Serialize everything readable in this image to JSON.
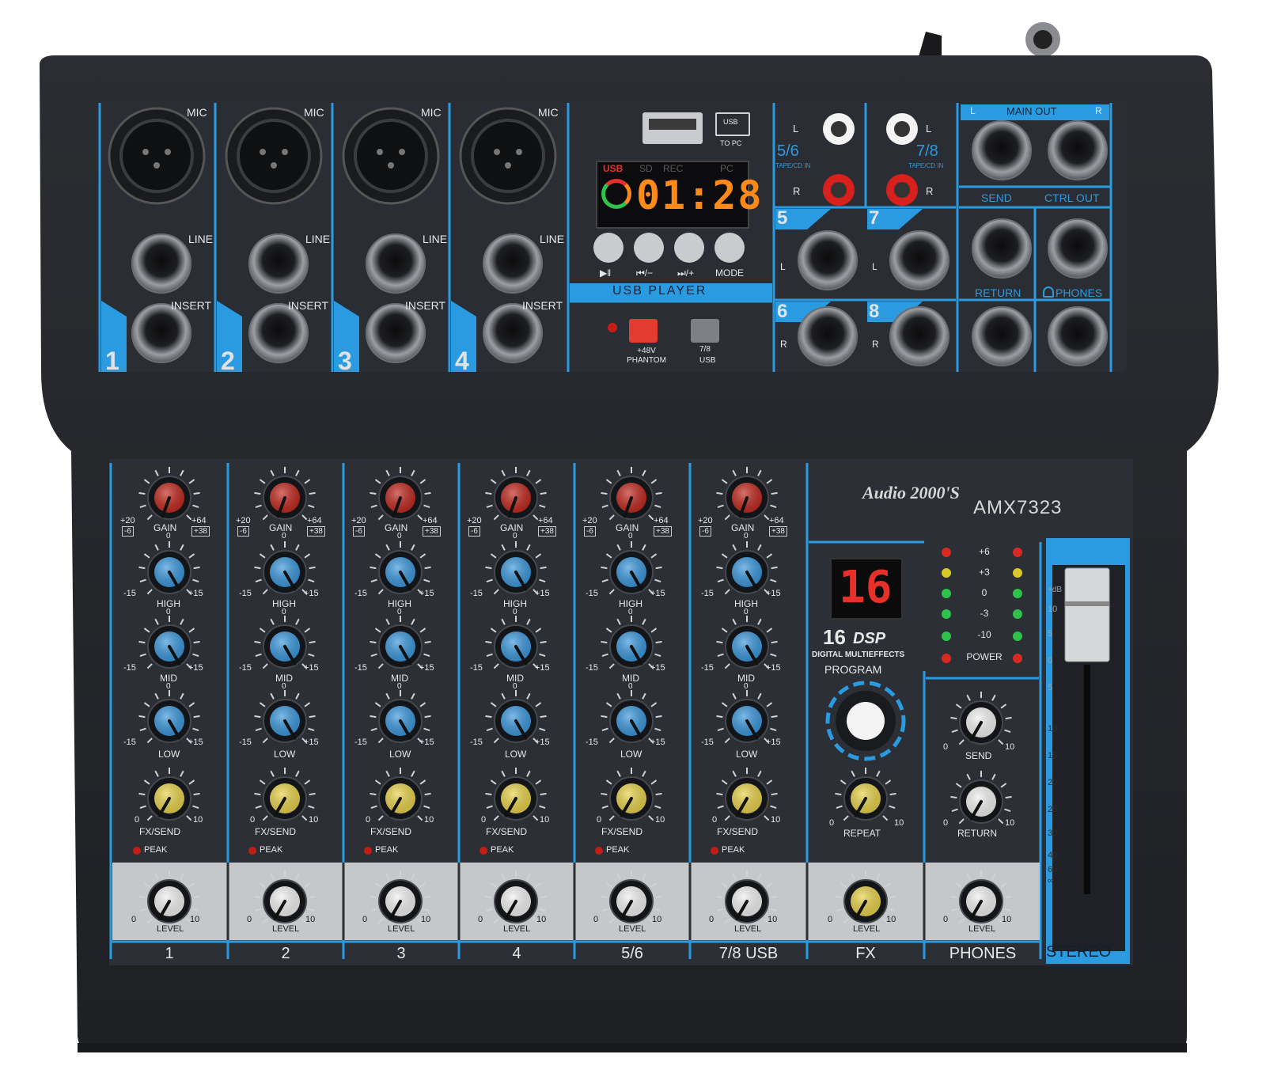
{
  "brand": {
    "logo_text": "Audio 2000'S",
    "model": "AMX7323"
  },
  "inputs": {
    "channels": [
      {
        "number": "1",
        "mic": "MIC",
        "line": "LINE",
        "insert": "INSERT"
      },
      {
        "number": "2",
        "mic": "MIC",
        "line": "LINE",
        "insert": "INSERT"
      },
      {
        "number": "3",
        "mic": "MIC",
        "line": "LINE",
        "insert": "INSERT"
      },
      {
        "number": "4",
        "mic": "MIC",
        "line": "LINE",
        "insert": "INSERT"
      }
    ]
  },
  "usb_player": {
    "title": "USB PLAYER",
    "to_pc": "TO PC",
    "usb_icon_label": "USB",
    "display": {
      "usb": "USB",
      "sd": "SD",
      "rec": "REC",
      "pc": "PC",
      "time": "01:28"
    },
    "buttons": [
      "▶‖",
      "⏮/−",
      "⏭/+",
      "MODE"
    ]
  },
  "switches": {
    "phantom": "+48V PHANTOM",
    "source_top": "7/8",
    "source_bottom": "USB"
  },
  "tape_inputs": {
    "left_group": {
      "label": "5/6",
      "sub": "TAPE/CD IN"
    },
    "right_group": {
      "label": "7/8",
      "sub": "TAPE/CD IN"
    },
    "l": "L",
    "r": "R"
  },
  "stereo_inputs": {
    "ch5": "5",
    "ch6": "6",
    "ch7": "7",
    "ch8": "8",
    "l": "L",
    "r": "R"
  },
  "outputs": {
    "main_out": "MAIN OUT",
    "l": "L",
    "r": "R",
    "send": "SEND",
    "ctrl_out": "CTRL OUT",
    "return": "RETURN",
    "phones": "PHONES"
  },
  "channel_strip": {
    "gain": {
      "label": "GAIN",
      "min_top": "+20",
      "min_bottom": "-6",
      "max_top": "+64",
      "max_bottom": "+38",
      "zero": "0"
    },
    "high": {
      "label": "HIGH",
      "min": "-15",
      "max": "+15",
      "zero": "0"
    },
    "mid": {
      "label": "MID",
      "min": "-15",
      "max": "+15",
      "zero": "0"
    },
    "low": {
      "label": "LOW",
      "min": "-15",
      "max": "+15",
      "zero": "0"
    },
    "fx": {
      "label": "FX/SEND",
      "min": "0",
      "max": "10"
    },
    "peak": "PEAK",
    "level": {
      "label": "LEVEL",
      "min": "0",
      "max": "10"
    }
  },
  "channel_labels": [
    "1",
    "2",
    "3",
    "4",
    "5/6",
    "7/8 USB",
    "FX",
    "PHONES"
  ],
  "dsp": {
    "program_display": "16",
    "count": "16",
    "dsp_text": "DSP",
    "desc": "DIGITAL MULTIEFFECTS",
    "program": "PROGRAM",
    "repeat": "REPEAT",
    "send": "SEND",
    "return": "RETURN",
    "zero": "0",
    "ten": "10"
  },
  "meter": {
    "labels": [
      "+6",
      "+3",
      "0",
      "-3",
      "-10",
      "POWER"
    ]
  },
  "fader": {
    "title": "STEREO",
    "scale": [
      "+dB",
      "10",
      "5",
      "0",
      "5",
      "10",
      "15",
      "20",
      "25",
      "30",
      "40",
      "60",
      "∞"
    ]
  },
  "colors": {
    "panel": "#2c2f36",
    "accent": "#2a9be0",
    "gain_knob": "#c0281e",
    "eq_knob": "#3a97dc",
    "fx_knob": "#e8d24a",
    "level_knob": "#f2f2f2",
    "display_digits": "#ff8a1a",
    "led_red": "#e8302a"
  }
}
